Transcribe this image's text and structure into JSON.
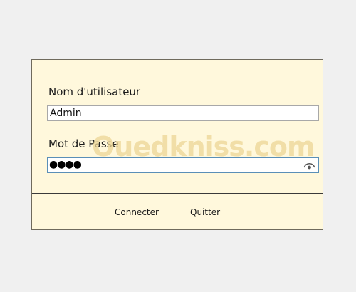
{
  "dialog": {
    "username_label": "Nom d'utilisateur",
    "username_value": "Admin",
    "password_label": "Mot de Passe",
    "password_mask": "●●●●",
    "connect_label": "Connecter",
    "quit_label": "Quitter"
  },
  "watermark": {
    "text": "Ouedkniss.com"
  },
  "icons": {
    "password_toggle": "eye-icon"
  },
  "colors": {
    "dialog_background": "#fff8dc",
    "focus_border": "#5a8fb7"
  }
}
